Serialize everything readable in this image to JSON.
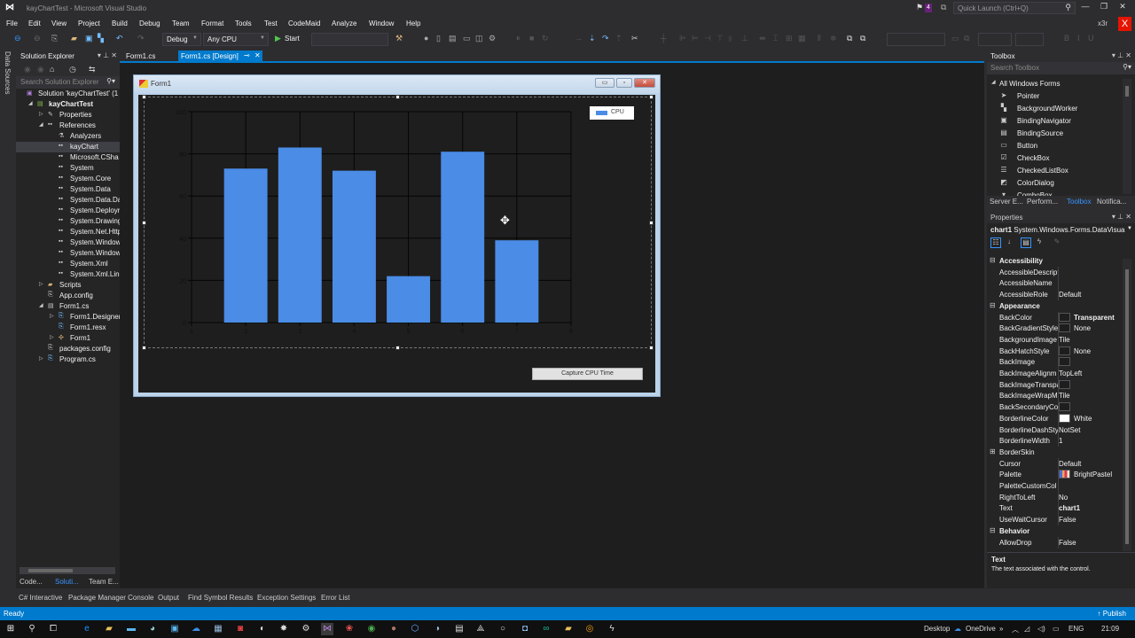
{
  "window": {
    "title": "kayChartTest - Microsoft Visual Studio",
    "notification_count": "4",
    "quick_launch_placeholder": "Quick Launch (Ctrl+Q)",
    "user": "x3r"
  },
  "menu": [
    "File",
    "Edit",
    "View",
    "Project",
    "Build",
    "Debug",
    "Team",
    "Format",
    "Tools",
    "Test",
    "CodeMaid",
    "Analyze",
    "Window",
    "Help"
  ],
  "toolbar": {
    "configuration": "Debug",
    "platform": "Any CPU",
    "start_label": "Start"
  },
  "side_strip": {
    "data_sources": "Data Sources"
  },
  "solution_explorer": {
    "title": "Solution Explorer",
    "search_placeholder": "Search Solution Explorer",
    "tree": [
      {
        "label": "Solution 'kayChartTest' (1",
        "icon": "solution-icon",
        "indent": 0,
        "expander": ""
      },
      {
        "label": "kayChartTest",
        "icon": "csproj-icon",
        "indent": 1,
        "expander": "expanded",
        "bold": true
      },
      {
        "label": "Properties",
        "icon": "wrench-icon",
        "indent": 2,
        "expander": "collapsed"
      },
      {
        "label": "References",
        "icon": "reference-icon",
        "indent": 2,
        "expander": "expanded"
      },
      {
        "label": "Analyzers",
        "icon": "analyzer-icon",
        "indent": 3,
        "expander": ""
      },
      {
        "label": "kayChart",
        "icon": "reference-icon",
        "indent": 3,
        "expander": "",
        "selected": true
      },
      {
        "label": "Microsoft.CSha",
        "icon": "reference-icon",
        "indent": 3,
        "expander": ""
      },
      {
        "label": "System",
        "icon": "reference-icon",
        "indent": 3,
        "expander": ""
      },
      {
        "label": "System.Core",
        "icon": "reference-icon",
        "indent": 3,
        "expander": ""
      },
      {
        "label": "System.Data",
        "icon": "reference-icon",
        "indent": 3,
        "expander": ""
      },
      {
        "label": "System.Data.Da",
        "icon": "reference-icon",
        "indent": 3,
        "expander": ""
      },
      {
        "label": "System.Deployr",
        "icon": "reference-icon",
        "indent": 3,
        "expander": ""
      },
      {
        "label": "System.Drawing",
        "icon": "reference-icon",
        "indent": 3,
        "expander": ""
      },
      {
        "label": "System.Net.Http",
        "icon": "reference-icon",
        "indent": 3,
        "expander": ""
      },
      {
        "label": "System.Window",
        "icon": "reference-icon",
        "indent": 3,
        "expander": ""
      },
      {
        "label": "System.Window",
        "icon": "reference-icon",
        "indent": 3,
        "expander": ""
      },
      {
        "label": "System.Xml",
        "icon": "reference-icon",
        "indent": 3,
        "expander": ""
      },
      {
        "label": "System.Xml.Lin",
        "icon": "reference-icon",
        "indent": 3,
        "expander": ""
      },
      {
        "label": "Scripts",
        "icon": "folder-icon",
        "indent": 2,
        "expander": "collapsed"
      },
      {
        "label": "App.config",
        "icon": "config-file-icon",
        "indent": 2,
        "expander": ""
      },
      {
        "label": "Form1.cs",
        "icon": "form-icon",
        "indent": 2,
        "expander": "expanded"
      },
      {
        "label": "Form1.Designer",
        "icon": "cs-file-icon",
        "indent": 3,
        "expander": "collapsed"
      },
      {
        "label": "Form1.resx",
        "icon": "resx-file-icon",
        "indent": 3,
        "expander": ""
      },
      {
        "label": "Form1",
        "icon": "class-icon",
        "indent": 3,
        "expander": "collapsed"
      },
      {
        "label": "packages.config",
        "icon": "config-file-icon",
        "indent": 2,
        "expander": ""
      },
      {
        "label": "Program.cs",
        "icon": "cs-file-icon",
        "indent": 2,
        "expander": "collapsed"
      }
    ],
    "bottom_tabs": [
      "Code...",
      "Soluti...",
      "Team E..."
    ]
  },
  "doc_tabs": [
    {
      "label": "Form1.cs",
      "active": false
    },
    {
      "label": "Form1.cs [Design]",
      "active": true
    }
  ],
  "form": {
    "title": "Form1",
    "button_label": "Capture CPU Time"
  },
  "chart_data": {
    "type": "bar",
    "title": "",
    "xlabel": "",
    "ylabel": "",
    "x": [
      2,
      3,
      4,
      5,
      6,
      7
    ],
    "series": [
      {
        "name": "CPU",
        "color": "#4a8ce6",
        "values": [
          73,
          83,
          72,
          22,
          81,
          39
        ]
      }
    ],
    "xlim": [
      1,
      8
    ],
    "ylim": [
      0,
      100
    ],
    "xticks": [
      "1",
      "2",
      "3",
      "4",
      "5",
      "6",
      "7",
      "8"
    ],
    "yticks": [
      "0",
      "20",
      "40",
      "60",
      "80",
      "100"
    ],
    "grid": true,
    "legend": "top-right",
    "background": "#1e1e1e"
  },
  "toolbox": {
    "title": "Toolbox",
    "search_placeholder": "Search Toolbox",
    "group": "All Windows Forms",
    "items": [
      {
        "label": "Pointer",
        "icon": "pointer-icon",
        "glyph": "➤"
      },
      {
        "label": "BackgroundWorker",
        "icon": "background-worker-icon",
        "glyph": "▚"
      },
      {
        "label": "BindingNavigator",
        "icon": "binding-navigator-icon",
        "glyph": "▣"
      },
      {
        "label": "BindingSource",
        "icon": "binding-source-icon",
        "glyph": "▤"
      },
      {
        "label": "Button",
        "icon": "button-icon",
        "glyph": "▭"
      },
      {
        "label": "CheckBox",
        "icon": "checkbox-icon",
        "glyph": "☑"
      },
      {
        "label": "CheckedListBox",
        "icon": "checked-listbox-icon",
        "glyph": "☰"
      },
      {
        "label": "ColorDialog",
        "icon": "color-dialog-icon",
        "glyph": "◩"
      },
      {
        "label": "ComboBox",
        "icon": "combobox-icon",
        "glyph": "▾"
      }
    ],
    "tabs": [
      "Server E...",
      "Perform...",
      "Toolbox",
      "Notifica..."
    ]
  },
  "properties": {
    "title": "Properties",
    "object_name": "chart1",
    "object_type": "System.Windows.Forms.DataVisua",
    "rows": [
      {
        "type": "cat",
        "name": "Accessibility",
        "exp": "⊟"
      },
      {
        "name": "AccessibleDescripti",
        "value": ""
      },
      {
        "name": "AccessibleName",
        "value": ""
      },
      {
        "name": "AccessibleRole",
        "value": "Default"
      },
      {
        "type": "cat",
        "name": "Appearance",
        "exp": "⊟"
      },
      {
        "name": "BackColor",
        "value": "Transparent",
        "swatch": "#1e1e1e",
        "bold": true
      },
      {
        "name": "BackGradientStyle",
        "value": "None",
        "swatch": "#1e1e1e"
      },
      {
        "name": "BackgroundImage",
        "value": "Tile"
      },
      {
        "name": "BackHatchStyle",
        "value": "None",
        "swatch": "#1e1e1e"
      },
      {
        "name": "BackImage",
        "value": "",
        "swatch": "#1e1e1e"
      },
      {
        "name": "BackImageAlignm",
        "value": "TopLeft"
      },
      {
        "name": "BackImageTranspa",
        "value": "",
        "swatch": "#1e1e1e"
      },
      {
        "name": "BackImageWrapM",
        "value": "Tile"
      },
      {
        "name": "BackSecondaryCo",
        "value": "",
        "swatch": "#1e1e1e"
      },
      {
        "name": "BorderlineColor",
        "value": "White",
        "swatch": "#ffffff"
      },
      {
        "name": "BorderlineDashSty",
        "value": "NotSet"
      },
      {
        "name": "BorderlineWidth",
        "value": "1"
      },
      {
        "type": "cat",
        "name": "BorderSkin",
        "exp": "⊞",
        "plain": true
      },
      {
        "name": "Cursor",
        "value": "Default"
      },
      {
        "name": "Palette",
        "value": "BrightPastel",
        "swatch": "palette"
      },
      {
        "name": "PaletteCustomCol",
        "value": ""
      },
      {
        "name": "RightToLeft",
        "value": "No"
      },
      {
        "name": "Text",
        "value": "chart1",
        "bold": true
      },
      {
        "name": "UseWaitCursor",
        "value": "False"
      },
      {
        "type": "cat",
        "name": "Behavior",
        "exp": "⊟"
      },
      {
        "name": "AllowDrop",
        "value": "False"
      }
    ],
    "description_title": "Text",
    "description_text": "The text associated with the control."
  },
  "output_tabs": [
    "C# Interactive",
    "Package Manager Console",
    "Output",
    "Find Symbol Results",
    "Exception Settings",
    "Error List"
  ],
  "status": {
    "text": "Ready",
    "publish": "↑ Publish"
  },
  "taskbar": {
    "tray": {
      "desktop": "Desktop",
      "onedrive": "OneDrive",
      "lang": "ENG",
      "time": "21:09"
    }
  }
}
